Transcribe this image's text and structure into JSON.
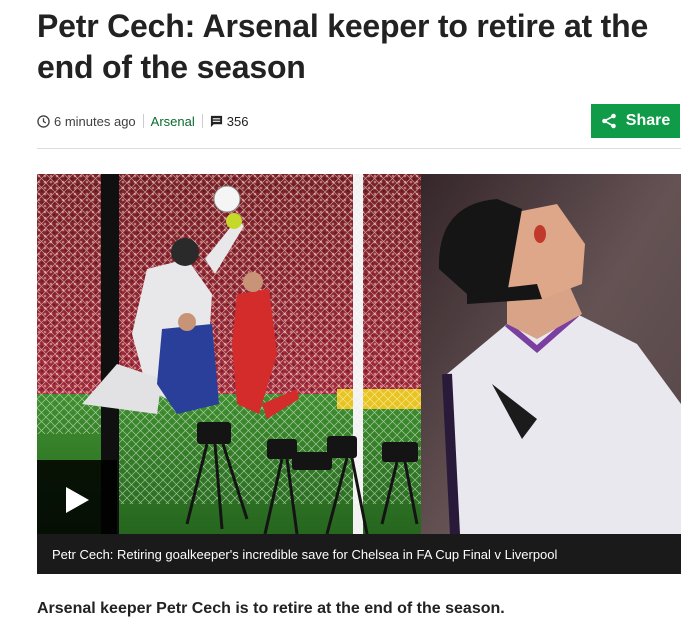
{
  "article": {
    "headline": "Petr Cech: Arsenal keeper to retire at the end of the season",
    "timestamp": "6 minutes ago",
    "topic": "Arsenal",
    "comment_count": "356",
    "share_label": "Share",
    "video_caption": "Petr Cech: Retiring goalkeeper's incredible save for Chelsea in FA Cup Final v Liverpool",
    "summary": "Arsenal keeper Petr Cech is to retire at the end of the season."
  },
  "icons": {
    "clock": "clock-icon",
    "comments": "comments-icon",
    "share": "share-icon",
    "play": "play-icon"
  },
  "colors": {
    "share_button": "#0f9b47",
    "topic_link": "#0b6b2e",
    "caption_bar": "#1a1a1a"
  }
}
